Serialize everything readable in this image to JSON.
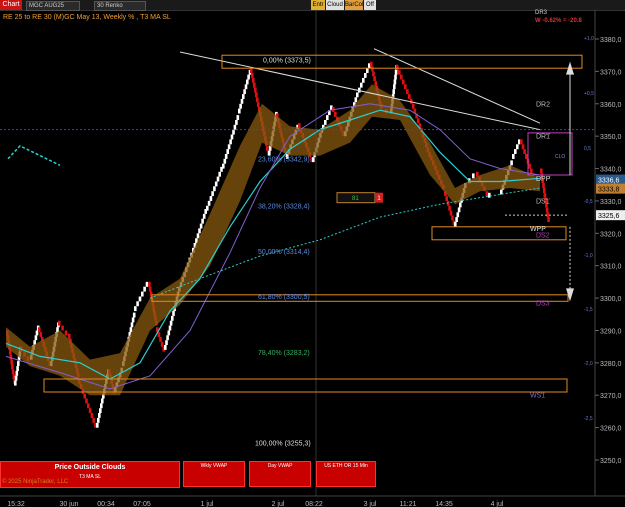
{
  "toolbar": {
    "chart_label": "Chart",
    "instrument": "MGC AUG25",
    "bar_type": "30 Renko",
    "buttons": [
      "Entr",
      "Cloud",
      "BarCol",
      "Off"
    ]
  },
  "title": "RE 25 to RE 30 (M)GC May 13, Weekly % , T3 MA SL",
  "top_right": {
    "dr3": "DR3",
    "change": "W -0.62% = -20.8"
  },
  "price_axis": [
    "3380,0",
    "3370,0",
    "3360,0",
    "3350,0",
    "3340,0",
    "3330,0",
    "3320,0",
    "3310,0",
    "3300,0",
    "3290,0",
    "3280,0",
    "3270,0",
    "3260,0",
    "3250,0"
  ],
  "percent_axis": [
    "+1,0",
    "+0,5",
    "0,5",
    "-0,5",
    "-1,0",
    "-1,5",
    "-2,0",
    "-2,5"
  ],
  "price_tags": {
    "last": "3336,6",
    "mid": "3333,8",
    "low": "3325,6"
  },
  "fib_levels": [
    {
      "label": "0,00% (3373,5)"
    },
    {
      "label": "23,60% (3342,9)"
    },
    {
      "label": "38,20% (3328,4)"
    },
    {
      "label": "50,00% (3314,4)"
    },
    {
      "label": "61,80% (3300,5)"
    },
    {
      "label": "78,40% (3283,2)"
    },
    {
      "label": "100,00% (3255,3)"
    }
  ],
  "pivot_labels": [
    "DR2",
    "DR1",
    "CLO",
    "DPP",
    "DS1",
    "WPP",
    "DS2",
    "DS3",
    "WS1"
  ],
  "box_81": {
    "left": "81",
    "right": "1"
  },
  "time_axis": [
    "15:32",
    "30 jun",
    "00:34",
    "07:05",
    "1 jul",
    "2 jul",
    "08:22",
    "3 jul",
    "11:21",
    "14:35",
    "4 jul"
  ],
  "bottom_buttons": {
    "main": "Price Outside Clouds",
    "main_sub": "T3 MA SL",
    "wkly": "Wkly VWAP",
    "day": "Day VWAP",
    "us": "US ETH OR 15 Min"
  },
  "copyright": "© 2025 NinjaTrader, LLC",
  "colors": {
    "up_brick": "#ffffff",
    "down_brick": "#e01010",
    "cloud": "#8a5a10",
    "fib_box": "#e08a20",
    "t3_cyan": "#2ad0d0",
    "vwap_purple": "#8060d0",
    "pivot_line": "#4040d0"
  }
}
